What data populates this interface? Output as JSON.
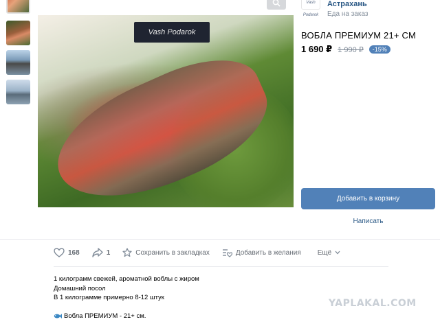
{
  "gallery": {
    "thumbnails": [
      "fish-photo-1",
      "fish-photo-2",
      "boat-photo",
      "river-photo"
    ]
  },
  "photo": {
    "bottle_label": "Vash Podarok"
  },
  "seller": {
    "logo_text": "Vash Podarok",
    "name": "Астрахань",
    "status": "Еда на заказ"
  },
  "product": {
    "title": "ВОБЛА ПРЕМИУМ 21+ СМ",
    "price": "1 690 ₽",
    "old_price": "1 990 ₽",
    "discount": "-15%",
    "add_to_cart": "Добавить в корзину",
    "write": "Написать"
  },
  "actions": {
    "likes": "168",
    "shares": "1",
    "bookmark": "Сохранить в закладках",
    "wishlist": "Добавить в желания",
    "more": "Ещё"
  },
  "description": {
    "line1": "1 килограмм свежей, ароматной воблы с жиром",
    "line2": "Домашний посол",
    "line3": "В 1 килограмме примерно 8-12 штук",
    "line4": "Вобла ПРЕМИУМ - 21+ см."
  },
  "watermark": "YAPLAKAL.COM",
  "colors": {
    "accent": "#5181b8",
    "link": "#2a5885",
    "muted": "#818c99"
  }
}
